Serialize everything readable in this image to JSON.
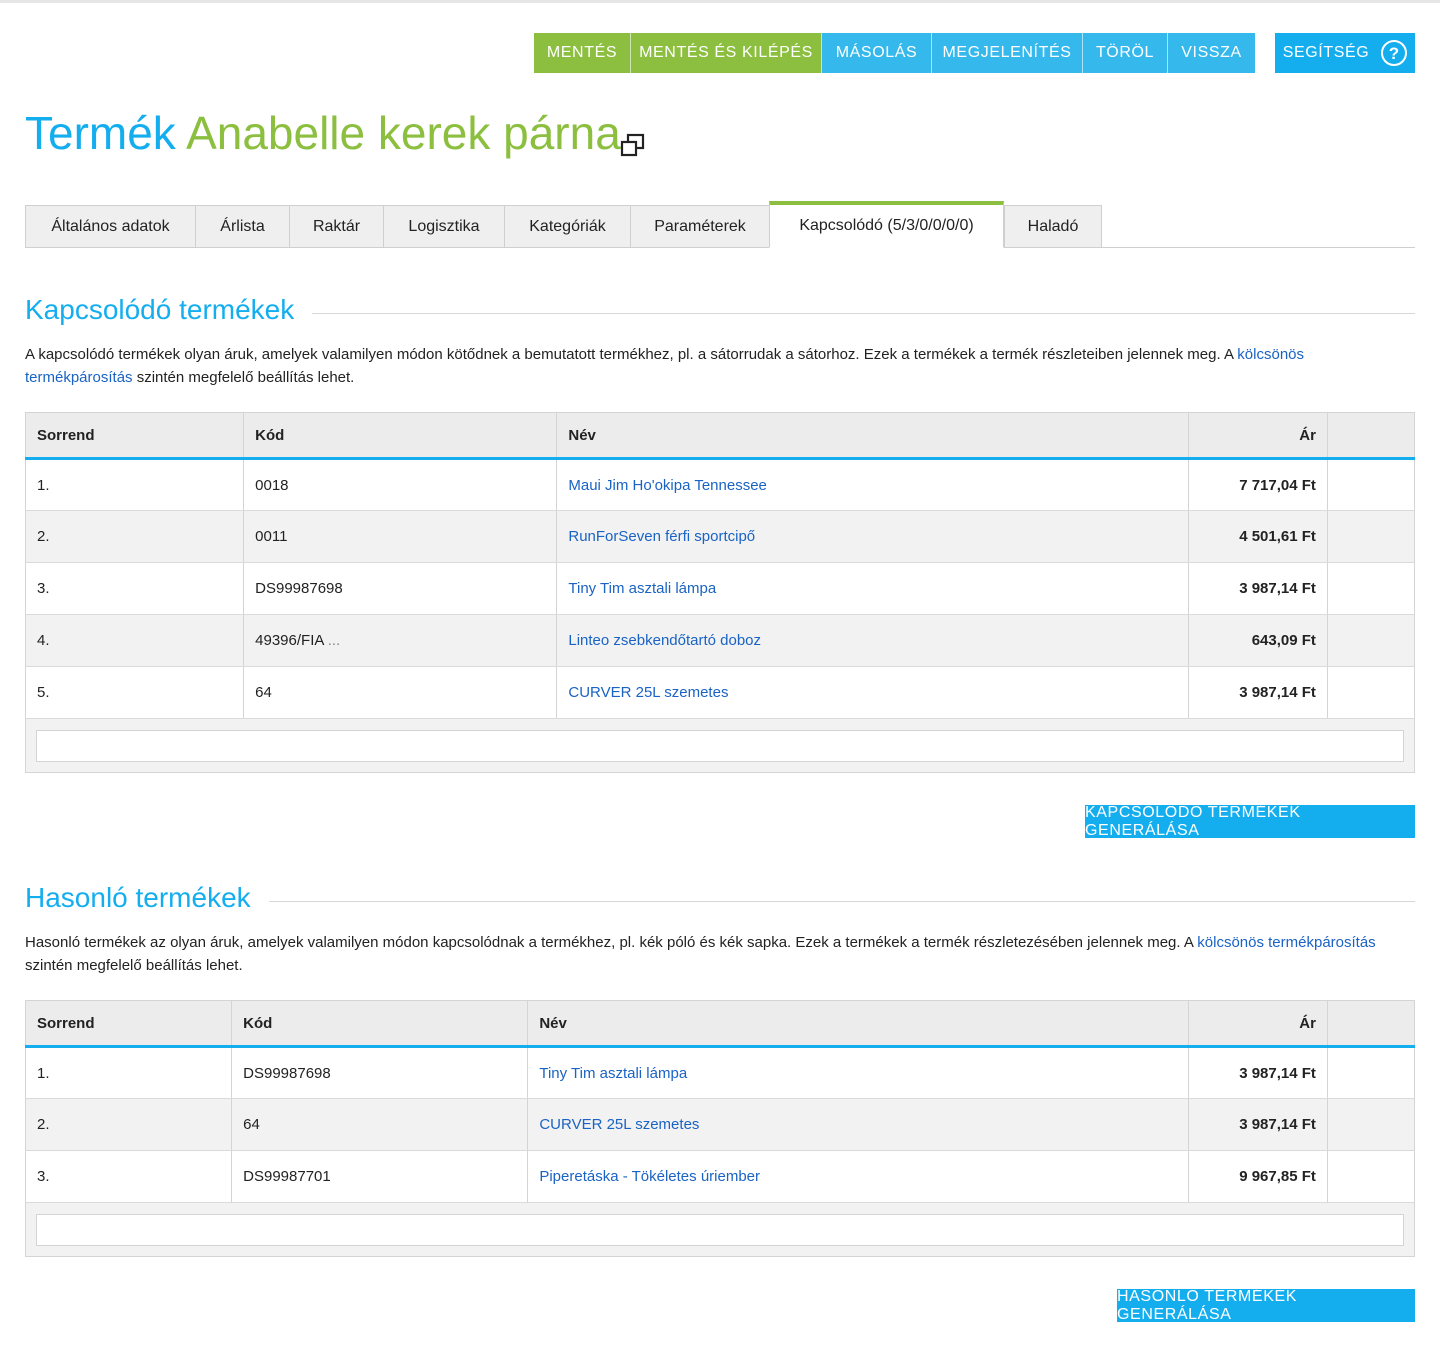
{
  "toolbar": {
    "save": "MENTÉS",
    "save_exit": "MENTÉS ÉS KILÉPÉS",
    "copy": "MÁSOLÁS",
    "view": "MEGJELENÍTÉS",
    "delete": "TÖRÖL",
    "back": "VISSZA",
    "help": "SEGÍTSÉG",
    "help_icon": "?"
  },
  "title": {
    "prefix": "Termék",
    "name": "Anabelle kerek párna"
  },
  "tabs": [
    "Általános adatok",
    "Árlista",
    "Raktár",
    "Logisztika",
    "Kategóriák",
    "Paraméterek",
    "Kapcsolódó (5/3/0/0/0/0)",
    "Haladó"
  ],
  "active_tab": "Kapcsolódó (5/3/0/0/0/0)",
  "related": {
    "title": "Kapcsolódó termékek",
    "desc_text": "A kapcsolódó termékek olyan áruk, amelyek valamilyen módon kötődnek a bemutatott termékhez, pl. a sátorrudak a sátorhoz. Ezek a termékek a termék részleteiben jelennek meg. A",
    "desc_link": "kölcsönös termékpárosítás",
    "desc_tail": "szintén megfelelő beállítás lehet.",
    "columns": {
      "order": "Sorrend",
      "code": "Kód",
      "name": "Név",
      "price": "Ár"
    },
    "rows": [
      {
        "order": "1.",
        "code": "0018",
        "name": "Maui Jim Ho'okipa Tennessee",
        "price": "7 717,04 Ft"
      },
      {
        "order": "2.",
        "code": "0011",
        "name": "RunForSeven férfi sportcipő",
        "price": "4 501,61 Ft"
      },
      {
        "order": "3.",
        "code": "DS99987698",
        "name": "Tiny Tim asztali lámpa",
        "price": "3 987,14 Ft"
      },
      {
        "order": "4.",
        "code": "49396/FIA",
        "code_more": "...",
        "name": "Linteo zsebkendőtartó doboz",
        "price": "643,09 Ft"
      },
      {
        "order": "5.",
        "code": "64",
        "name": "CURVER 25L szemetes",
        "price": "3 987,14 Ft"
      }
    ],
    "generate": "KAPCSOLÓDÓ TERMÉKEK GENERÁLÁSA"
  },
  "similar": {
    "title": "Hasonló termékek",
    "desc_text": "Hasonló termékek az olyan áruk, amelyek valamilyen módon kapcsolódnak a termékhez, pl. kék póló és kék sapka. Ezek a termékek a termék részletezésében jelennek meg. A",
    "desc_link": "kölcsönös termékpárosítás",
    "desc_tail": "szintén megfelelő beállítás lehet.",
    "columns": {
      "order": "Sorrend",
      "code": "Kód",
      "name": "Név",
      "price": "Ár"
    },
    "rows": [
      {
        "order": "1.",
        "code": "DS99987698",
        "name": "Tiny Tim asztali lámpa",
        "price": "3 987,14 Ft"
      },
      {
        "order": "2.",
        "code": "64",
        "name": "CURVER 25L szemetes",
        "price": "3 987,14 Ft"
      },
      {
        "order": "3.",
        "code": "DS99987701",
        "name": "Piperetáska - Tökéletes úriember",
        "price": "9 967,85 Ft"
      }
    ],
    "generate": "HASONLÓ TERMÉKEK GENERÁLÁSA"
  },
  "colors": {
    "green": "#8cbf3f",
    "blue": "#35b8ec",
    "accent": "#14aeef",
    "link": "#1a63c4"
  },
  "icons": {
    "copy": "copy-icon",
    "help": "help-circle-icon"
  }
}
